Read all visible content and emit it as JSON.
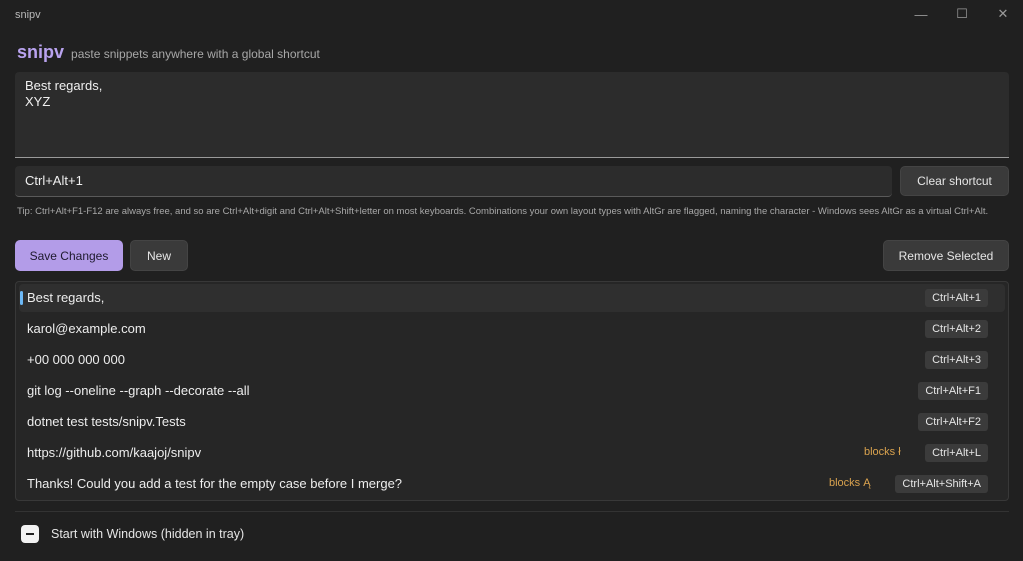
{
  "window": {
    "title": "snipv",
    "minimize_glyph": "—",
    "maximize_glyph": "☐",
    "close_glyph": "✕"
  },
  "header": {
    "app_name": "snipv",
    "tagline": "paste snippets anywhere with a global shortcut"
  },
  "editor": {
    "text": "Best regards,\nXYZ"
  },
  "shortcut": {
    "value": "Ctrl+Alt+1",
    "clear_label": "Clear shortcut"
  },
  "tip": "Tip: Ctrl+Alt+F1-F12 are always free, and so are Ctrl+Alt+digit and Ctrl+Alt+Shift+letter on most keyboards. Combinations your own layout types with AltGr are flagged, naming the character - Windows sees AltGr as a virtual Ctrl+Alt.",
  "actions": {
    "save_label": "Save Changes",
    "new_label": "New",
    "remove_label": "Remove Selected"
  },
  "snippets": [
    {
      "label": "Best regards,",
      "shortcut": "Ctrl+Alt+1",
      "warning": "",
      "selected": true
    },
    {
      "label": "karol@example.com",
      "shortcut": "Ctrl+Alt+2",
      "warning": "",
      "selected": false
    },
    {
      "label": "+00 000 000 000",
      "shortcut": "Ctrl+Alt+3",
      "warning": "",
      "selected": false
    },
    {
      "label": "git log --oneline --graph --decorate --all",
      "shortcut": "Ctrl+Alt+F1",
      "warning": "",
      "selected": false
    },
    {
      "label": "dotnet test tests/snipv.Tests",
      "shortcut": "Ctrl+Alt+F2",
      "warning": "",
      "selected": false
    },
    {
      "label": "https://github.com/kaajoj/snipv",
      "shortcut": "Ctrl+Alt+L",
      "warning": "blocks ł",
      "selected": false
    },
    {
      "label": "Thanks! Could you add a test for the empty case before I merge?",
      "shortcut": "Ctrl+Alt+Shift+A",
      "warning": "blocks Ą",
      "selected": false
    }
  ],
  "startup": {
    "label": "Start with Windows (hidden in tray)",
    "state": "indeterminate"
  },
  "colors": {
    "accent": "#b39ce8",
    "selection_marker": "#6cb8f6",
    "warning": "#d9a24e",
    "background": "#202020"
  }
}
